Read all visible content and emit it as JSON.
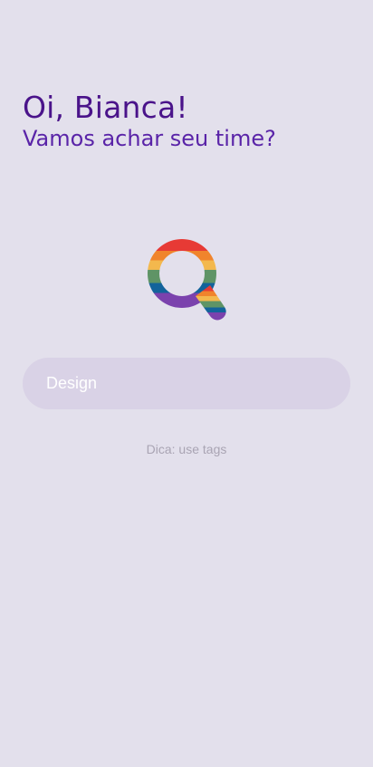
{
  "header": {
    "greeting": "Oi, Bianca!",
    "subtitle": "Vamos achar seu time?"
  },
  "logo": {
    "icon": "rainbow-search-magnifier-icon",
    "colors": [
      "#e73a35",
      "#f0842c",
      "#f3b84d",
      "#5f9466",
      "#13639b",
      "#7b42ad"
    ]
  },
  "search": {
    "placeholder": "Design"
  },
  "hint": {
    "text": "Dica: use tags"
  },
  "theme": {
    "background": "#e3e0ec",
    "primary": "#4a138a",
    "input_background": "#d9d2e6"
  }
}
